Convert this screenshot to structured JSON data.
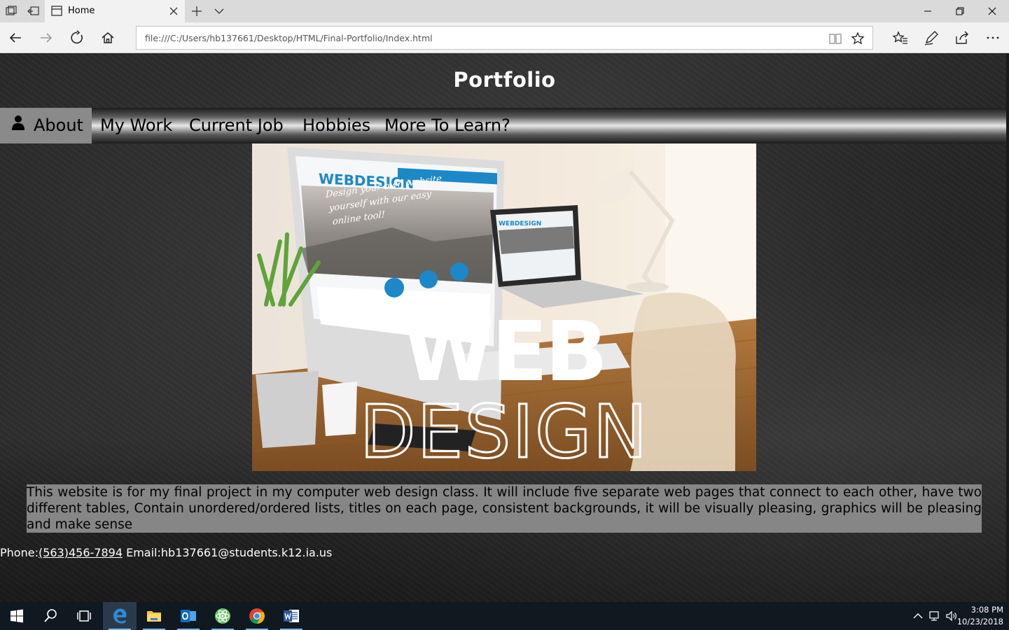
{
  "browser": {
    "tab_title": "Home",
    "address_url": "file:///C:/Users/hb137661/Desktop/HTML/Final-Portfolio/Index.html"
  },
  "site": {
    "title": "Portfolio",
    "nav": [
      {
        "label": "About",
        "icon": "user-icon",
        "active": true
      },
      {
        "label": "My Work"
      },
      {
        "label": "Current Job"
      },
      {
        "label": "Hobbies"
      },
      {
        "label": "More To Learn?"
      }
    ],
    "hero": {
      "headline_top": "WEB",
      "headline_bottom": "DESIGN",
      "monitor_brand": "WEBDESIGN",
      "monitor_tagline_1": "Design your own website",
      "monitor_tagline_2": "yourself with our easy",
      "monitor_tagline_3": "online tool!",
      "laptop_brand": "WEBDESIGN"
    },
    "intro_text": "This website is for my final project in my computer web design class. It will include five separate web pages that connect to each other, have two different tables, Contain unordered/ordered lists, titles on each page, consistent backgrounds, it will be visually pleasing, graphics will be pleasing and make sense",
    "contact": {
      "phone_label": "Phone:",
      "phone": "(563)456-7894",
      "email_label": "Email:",
      "email": "hb137661@students.k12.ia.us"
    }
  },
  "taskbar": {
    "apps": [
      "start-icon",
      "search-icon",
      "task-view-icon",
      "edge-icon",
      "file-explorer-icon",
      "outlook-icon",
      "atom-icon",
      "chrome-icon",
      "word-icon"
    ],
    "time": "3:08 PM",
    "date": "10/23/2018"
  },
  "colors": {
    "nav_active": "#8a8a8a",
    "intro_bg": "#868686",
    "taskbar": "#101820",
    "edge_blue": "#0078d7"
  }
}
